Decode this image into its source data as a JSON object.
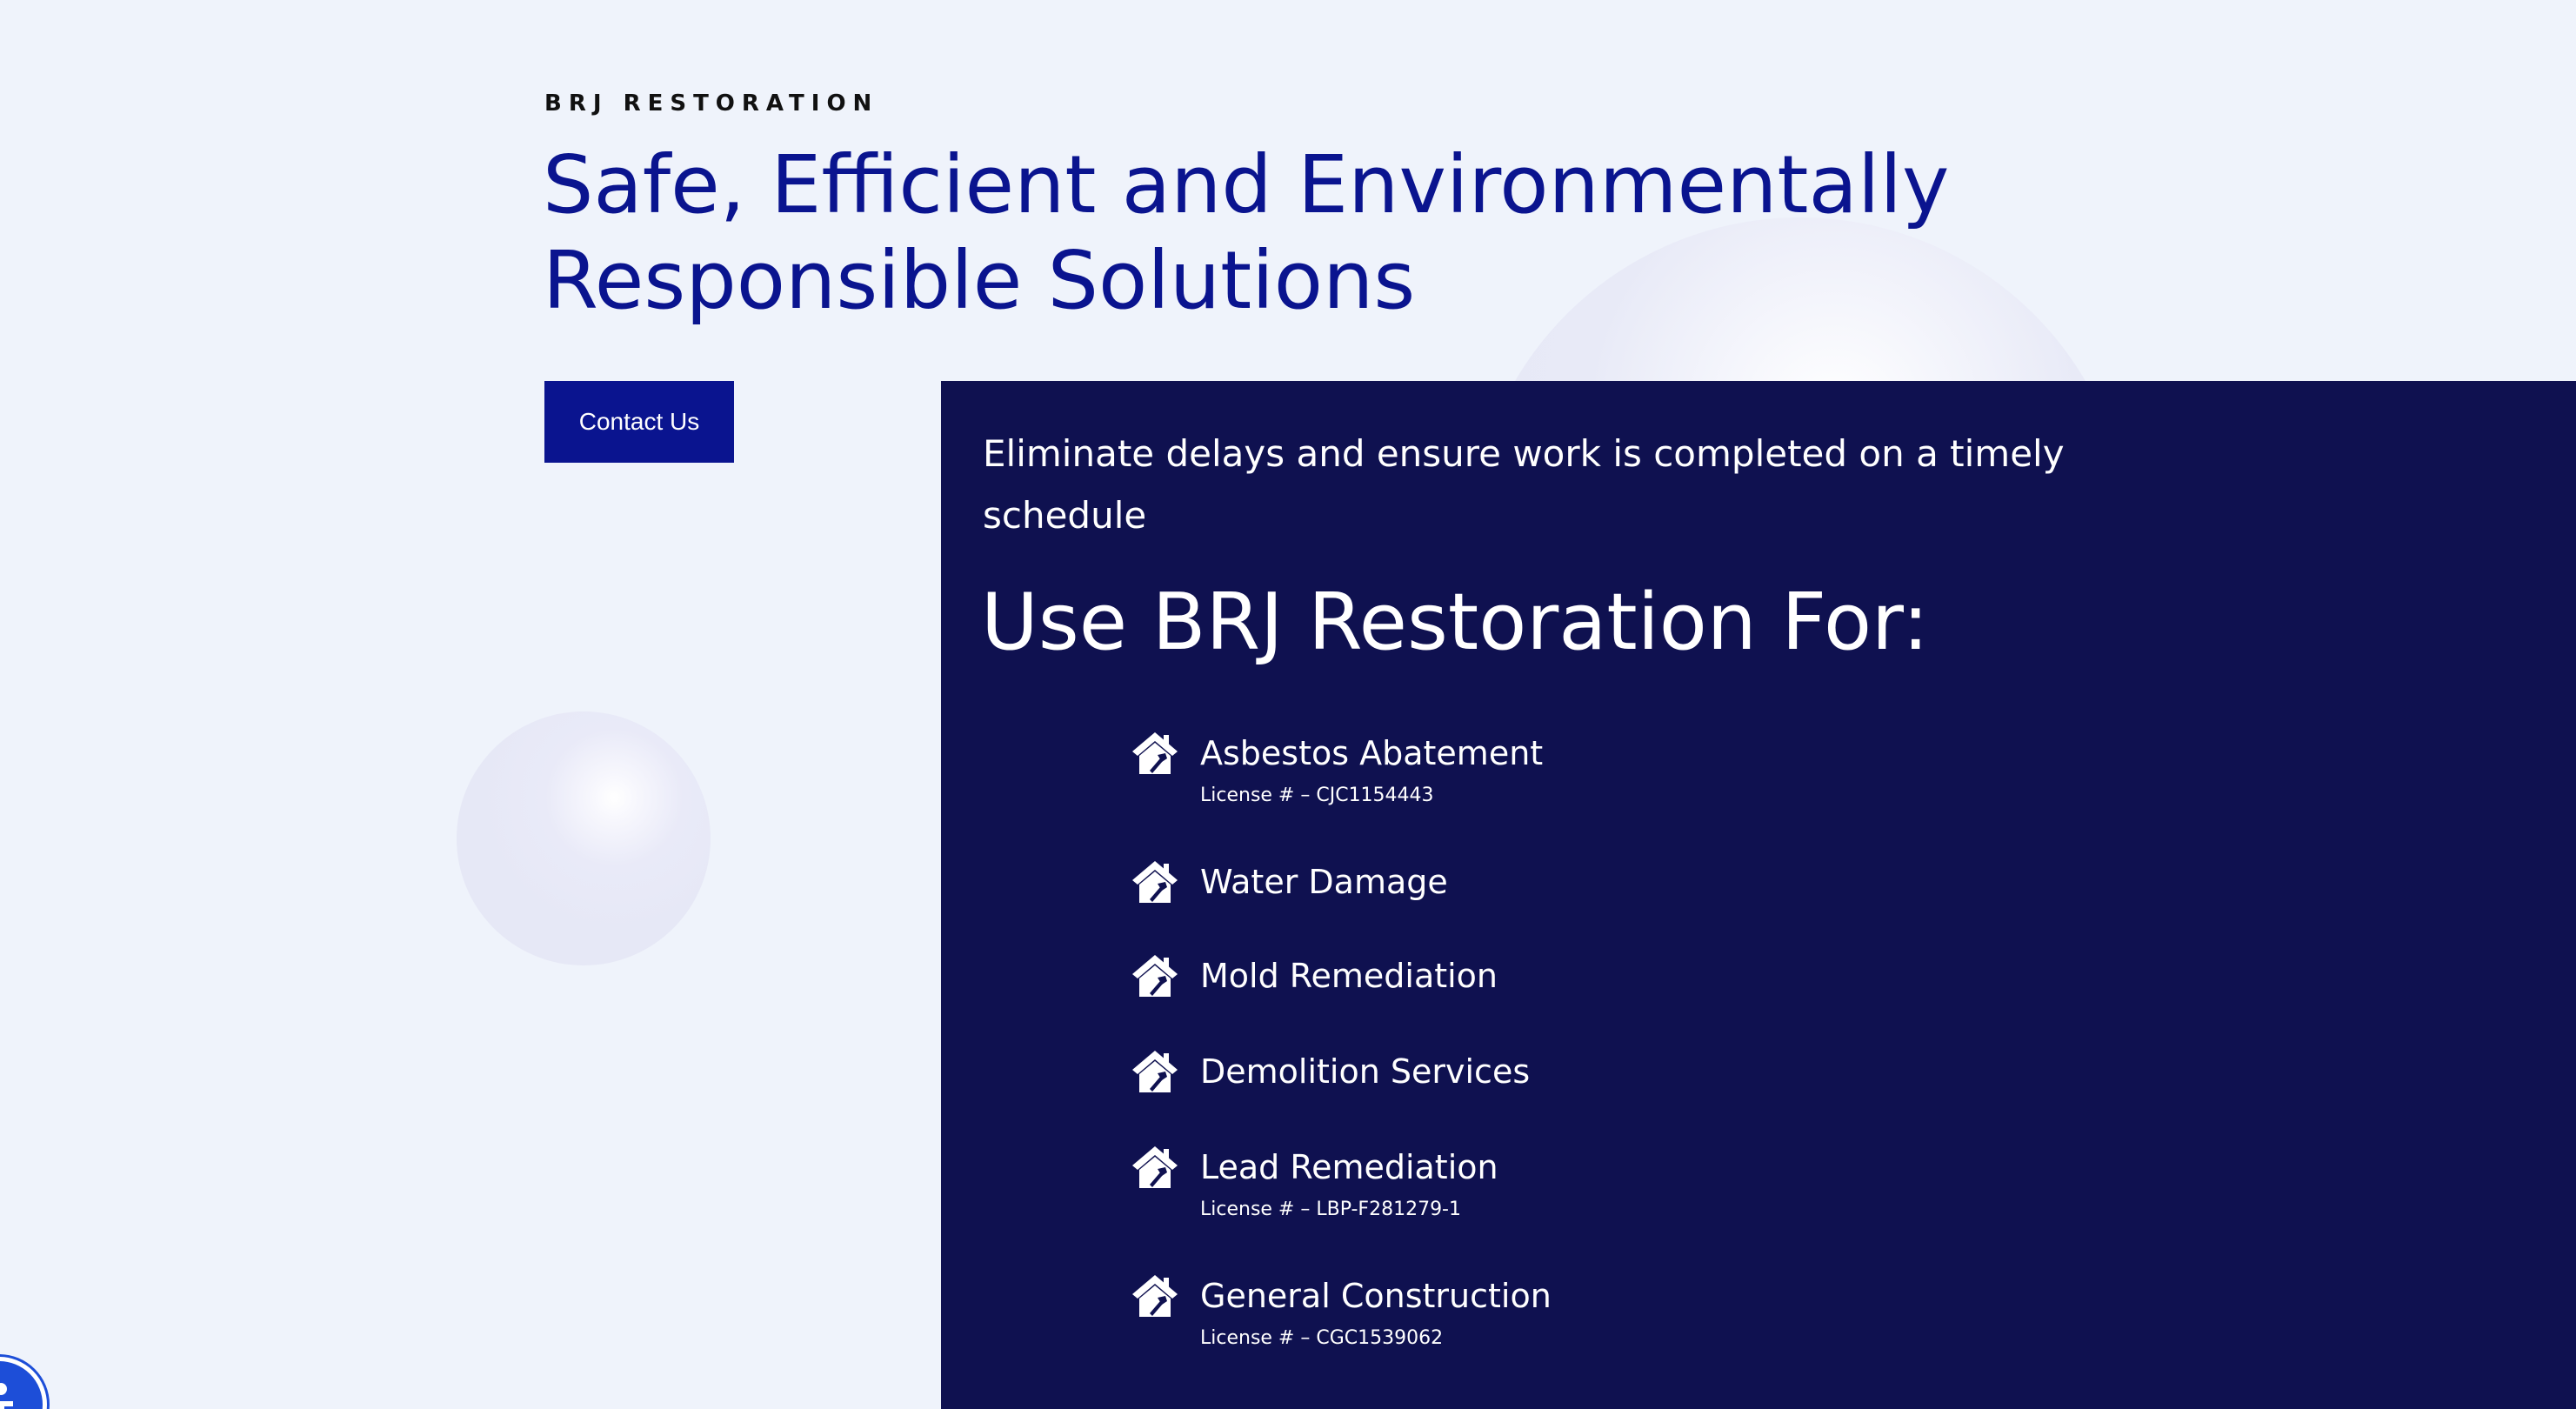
{
  "hero": {
    "eyebrow": "BRJ RESTORATION",
    "headline_line1": "Safe, Efficient and Environmentally",
    "headline_line2": "Responsible Solutions",
    "contact_label": "Contact Us"
  },
  "panel": {
    "intro_line1": "Eliminate delays and ensure work is completed on a timely",
    "intro_line2": "schedule",
    "heading": "Use BRJ Restoration For:",
    "services": [
      {
        "name": "Asbestos Abatement",
        "license": "License # – CJC1154443",
        "icon": "house-repair-icon"
      },
      {
        "name": "Water Damage",
        "license": "",
        "icon": "house-repair-icon"
      },
      {
        "name": "Mold Remediation",
        "license": "",
        "icon": "house-repair-icon"
      },
      {
        "name": "Demolition Services",
        "license": "",
        "icon": "house-repair-icon"
      },
      {
        "name": "Lead Remediation",
        "license": "License # – LBP-F281279-1",
        "icon": "house-repair-icon"
      },
      {
        "name": "General Construction",
        "license": "License # – CGC1539062",
        "icon": "house-repair-icon"
      }
    ]
  },
  "colors": {
    "background": "#eff3fb",
    "brand_blue": "#0a148f",
    "panel_navy": "#0f1150",
    "accessibility_blue": "#1d4ed8"
  },
  "widgets": {
    "accessibility_icon": "accessibility-icon"
  }
}
